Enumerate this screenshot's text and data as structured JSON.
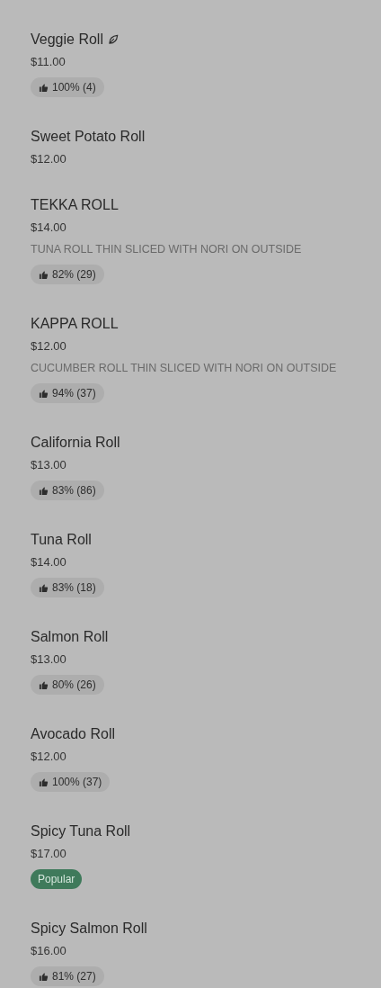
{
  "menu_items": [
    {
      "name": "Veggie Roll",
      "vegetarian": true,
      "price": "$11.00",
      "badge": {
        "kind": "rating",
        "text": "100% (4)"
      }
    },
    {
      "name": "Sweet Potato Roll",
      "vegetarian": false,
      "price": "$12.00"
    },
    {
      "name": "TEKKA ROLL",
      "vegetarian": false,
      "price": "$14.00",
      "description": "TUNA ROLL THIN SLICED WITH NORI ON OUTSIDE",
      "badge": {
        "kind": "rating",
        "text": "82% (29)"
      }
    },
    {
      "name": "KAPPA ROLL",
      "vegetarian": false,
      "price": "$12.00",
      "description": "CUCUMBER ROLL THIN SLICED WITH NORI ON OUTSIDE",
      "badge": {
        "kind": "rating",
        "text": "94% (37)"
      }
    },
    {
      "name": "California Roll",
      "vegetarian": false,
      "price": "$13.00",
      "badge": {
        "kind": "rating",
        "text": "83% (86)"
      }
    },
    {
      "name": "Tuna Roll",
      "vegetarian": false,
      "price": "$14.00",
      "badge": {
        "kind": "rating",
        "text": "83% (18)"
      }
    },
    {
      "name": "Salmon Roll",
      "vegetarian": false,
      "price": "$13.00",
      "badge": {
        "kind": "rating",
        "text": "80% (26)"
      }
    },
    {
      "name": "Avocado Roll",
      "vegetarian": false,
      "price": "$12.00",
      "badge": {
        "kind": "rating",
        "text": "100% (37)"
      }
    },
    {
      "name": "Spicy Tuna Roll",
      "vegetarian": false,
      "price": "$17.00",
      "badge": {
        "kind": "popular",
        "text": "Popular"
      }
    },
    {
      "name": "Spicy Salmon Roll",
      "vegetarian": false,
      "price": "$16.00",
      "badge": {
        "kind": "rating",
        "text": "81% (27)"
      }
    }
  ]
}
